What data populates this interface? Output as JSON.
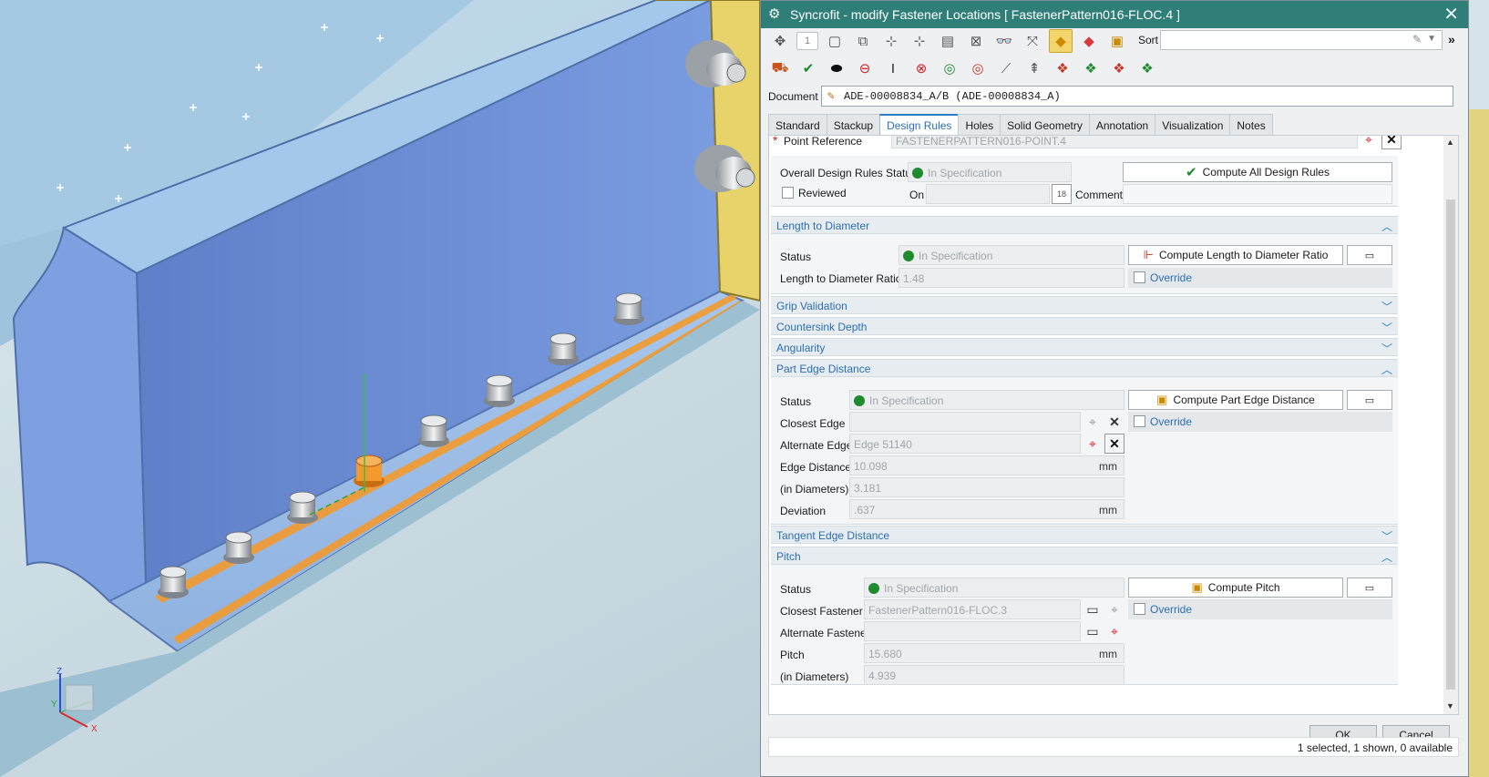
{
  "window": {
    "title": "Syncrofit - modify Fastener Locations [ FastenerPattern016-FLOC.4 ]"
  },
  "colors": {
    "accent": "#2f7f78",
    "link": "#2b6fb3",
    "status_green": "#1e8c2e",
    "part_blue": "#6d8fd6",
    "selected_orange": "#f39a2e"
  },
  "toolbar": {
    "counter": "1",
    "sort_label": "Sort",
    "sort_value": ""
  },
  "document": {
    "label": "Document",
    "value": "ADE-00008834_A/B (ADE-00008834_A)"
  },
  "tabs": [
    "Standard",
    "Stackup",
    "Design Rules",
    "Holes",
    "Solid Geometry",
    "Annotation",
    "Visualization",
    "Notes"
  ],
  "point_reference": {
    "required_mark": "*",
    "label": "Point Reference",
    "value": "FASTENERPATTERN016-POINT.4"
  },
  "overall": {
    "label": "Overall Design Rules Status",
    "status": "In Specification",
    "compute_all": "Compute All Design Rules",
    "reviewed_label": "Reviewed",
    "on_label": "On",
    "calendar_day": "18",
    "comment_label": "Comment"
  },
  "length_to_diameter": {
    "title": "Length to Diameter",
    "status_label": "Status",
    "status": "In Specification",
    "compute": "Compute Length to Diameter Ratio",
    "ratio_label": "Length to Diameter Ratio",
    "ratio": "1.48",
    "override": "Override"
  },
  "collapsed_sections": [
    "Grip Validation",
    "Countersink Depth",
    "Angularity"
  ],
  "part_edge_distance": {
    "title": "Part Edge Distance",
    "status_label": "Status",
    "status": "In Specification",
    "compute": "Compute Part Edge Distance",
    "closest_edge_label": "Closest Edge",
    "closest_edge": "",
    "alternate_edge_label": "Alternate Edge",
    "alternate_edge": "Edge 51140",
    "edge_distance_label": "Edge Distance",
    "edge_distance": "10.098",
    "edge_distance_unit": "mm",
    "in_diameters_label": "(in Diameters)",
    "in_diameters": "3.181",
    "deviation_label": "Deviation",
    "deviation": ".637",
    "deviation_unit": "mm",
    "override": "Override"
  },
  "tangent_edge_distance": {
    "title": "Tangent Edge Distance"
  },
  "pitch": {
    "title": "Pitch",
    "status_label": "Status",
    "status": "In Specification",
    "compute": "Compute Pitch",
    "closest_fastener_label": "Closest Fastener",
    "closest_fastener": "FastenerPattern016-FLOC.3",
    "alternate_fastener_label": "Alternate Fastener",
    "alternate_fastener": "",
    "pitch_label": "Pitch",
    "pitch": "15.680",
    "pitch_unit": "mm",
    "in_diameters_label": "(in Diameters)",
    "in_diameters": "4.939",
    "override": "Override"
  },
  "footer": {
    "ok": "OK",
    "cancel": "Cancel",
    "status": "1 selected, 1 shown, 0 available"
  },
  "axis": {
    "z": "Z",
    "y": "Y",
    "x": "X"
  }
}
